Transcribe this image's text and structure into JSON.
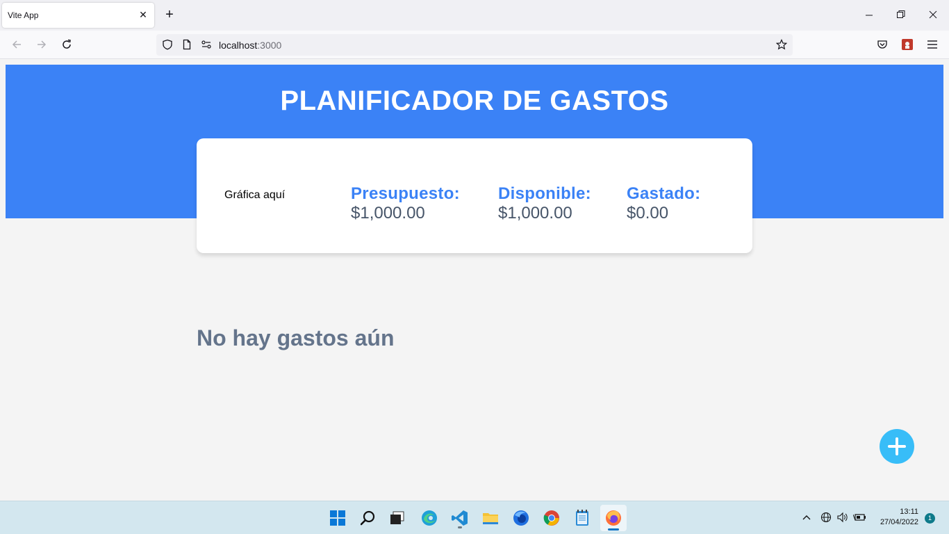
{
  "browser": {
    "tab_title": "Vite App",
    "url_host": "localhost",
    "url_port": ":3000"
  },
  "app": {
    "title": "PLANIFICADOR DE GASTOS",
    "chart_placeholder": "Gráfica aquí",
    "stats": [
      {
        "label": "Presupuesto:",
        "value": "$1,000.00"
      },
      {
        "label": "Disponible:",
        "value": "$1,000.00"
      },
      {
        "label": "Gastado:",
        "value": "$0.00"
      }
    ],
    "empty_message": "No hay gastos aún",
    "accent_color": "#3b82f6",
    "fab_color": "#38bdf8"
  },
  "taskbar": {
    "apps": [
      "windows-start-icon",
      "search-icon",
      "task-view-icon",
      "edge-icon",
      "vscode-icon",
      "file-explorer-icon",
      "firefox-developer-icon",
      "chrome-icon",
      "notepad-icon",
      "firefox-icon"
    ],
    "time": "13:11",
    "date": "27/04/2022",
    "notification_count": "1"
  }
}
